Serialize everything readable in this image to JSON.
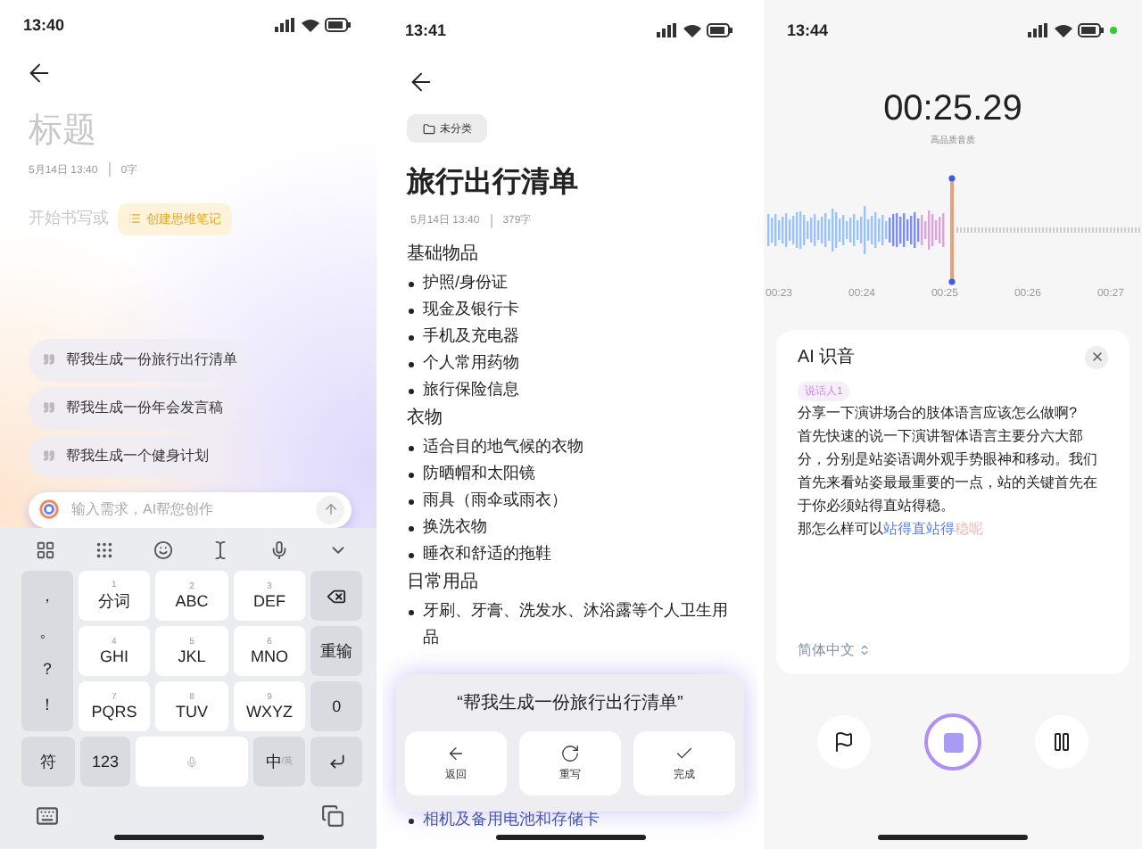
{
  "note_editor": {
    "time": "13:40",
    "title_placeholder": "标题",
    "date": "5月14日 13:40",
    "word_count": "0字",
    "start_text": "开始书写或",
    "mind_map_chip": "创建思维笔记",
    "suggestions": [
      "帮我生成一份旅行出行清单",
      "帮我生成一份年会发言稿",
      "帮我生成一个健身计划"
    ],
    "input": {
      "placeholder": "输入需求，AI帮您创作"
    },
    "keyboard": {
      "punctuation": [
        "，",
        "。",
        "？",
        "！"
      ],
      "keys": [
        {
          "digit": "1",
          "label": "分词"
        },
        {
          "digit": "2",
          "label": "ABC"
        },
        {
          "digit": "3",
          "label": "DEF"
        },
        {
          "digit": "4",
          "label": "GHI"
        },
        {
          "digit": "5",
          "label": "JKL"
        },
        {
          "digit": "6",
          "label": "MNO"
        },
        {
          "digit": "7",
          "label": "PQRS"
        },
        {
          "digit": "8",
          "label": "TUV"
        },
        {
          "digit": "9",
          "label": "WXYZ"
        }
      ],
      "retype": "重输",
      "zero": "0",
      "symbol": "符",
      "numbers": "123",
      "lang_main": "中",
      "lang_alt": "/英"
    }
  },
  "note_view": {
    "time": "13:41",
    "folder": "未分类",
    "title": "旅行出行清单",
    "date": "5月14日 13:40",
    "word_count": "379字",
    "sections": [
      {
        "heading": "基础物品",
        "items": [
          "护照/身份证",
          "现金及银行卡",
          "手机及充电器",
          "个人常用药物",
          "旅行保险信息"
        ]
      },
      {
        "heading": "衣物",
        "items": [
          "适合目的地气候的衣物",
          "防晒帽和太阳镜",
          "雨具（雨伞或雨衣）",
          "换洗衣物",
          "睡衣和舒适的拖鞋"
        ]
      },
      {
        "heading": "日常用品",
        "items": [
          "牙刷、牙膏、洗发水、沐浴露等个人卫生用品"
        ]
      }
    ],
    "tail_item": "相机及备用电池和存储卡",
    "ai_card": {
      "prompt": "“帮我生成一份旅行出行清单”",
      "actions": [
        {
          "kind": "back",
          "label": "返回"
        },
        {
          "kind": "rewrite",
          "label": "重写"
        },
        {
          "kind": "done",
          "label": "完成"
        }
      ]
    }
  },
  "recorder": {
    "time": "13:44",
    "timer": "00:25.29",
    "quality": "高品质音质",
    "ticks": [
      "00:23",
      "00:24",
      "00:25",
      "00:26",
      "00:27"
    ],
    "card": {
      "title": "AI 识音",
      "speaker": "说话人1",
      "paragraphs": [
        [
          {
            "kind": "final",
            "text": "分享一下演讲场合的肢体语言应该怎么做啊?"
          }
        ],
        [
          {
            "kind": "final",
            "text": "首先快速的说一下演讲智体语言主要分六大部分，分别是站姿语调外观手势眼神和移动。我们首先来看站姿最最重要的一点，站的关键首先在于你必须站得直站得稳。"
          }
        ],
        [
          {
            "kind": "final",
            "text": "那怎么样可以"
          },
          {
            "kind": "recent",
            "text": "站得直站得"
          },
          {
            "kind": "pending",
            "text": "稳呢"
          }
        ]
      ],
      "language": "简体中文"
    }
  }
}
